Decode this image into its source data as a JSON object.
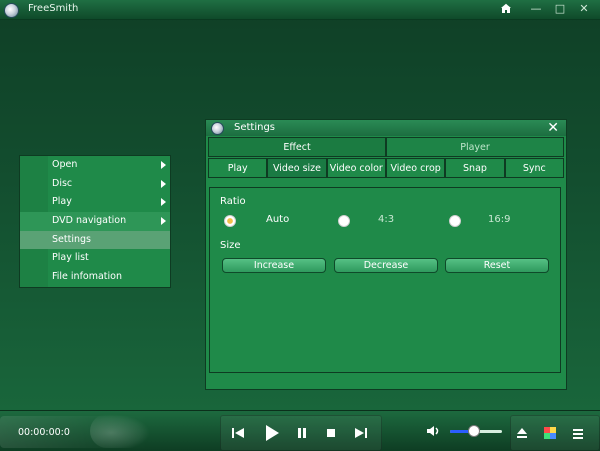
{
  "app": {
    "title": "FreeSmith"
  },
  "window_controls": {
    "home_icon": "home-icon",
    "minimize_icon": "minimize-icon",
    "restore_icon": "restore-icon",
    "close_icon": "close-icon"
  },
  "context_menu": {
    "items": [
      {
        "label": "Open",
        "has_submenu": true
      },
      {
        "label": "Disc",
        "has_submenu": true
      },
      {
        "label": "Play",
        "has_submenu": true
      },
      {
        "label": "DVD navigation",
        "has_submenu": true
      },
      {
        "label": "Settings",
        "has_submenu": false
      },
      {
        "label": "Play list",
        "has_submenu": false
      },
      {
        "label": "File infomation",
        "has_submenu": false
      }
    ]
  },
  "settings_dialog": {
    "title": "Settings",
    "tabs_top": [
      {
        "label": "Effect"
      },
      {
        "label": "Player"
      }
    ],
    "tabs_sub": [
      {
        "label": "Play"
      },
      {
        "label": "Video size"
      },
      {
        "label": "Video color"
      },
      {
        "label": "Video crop"
      },
      {
        "label": "Snap"
      },
      {
        "label": "Sync"
      }
    ],
    "selected_sub_tab": "Video size",
    "ratio": {
      "label": "Ratio",
      "options": [
        {
          "label": "Auto",
          "checked": true
        },
        {
          "label": "4:3",
          "checked": false
        },
        {
          "label": "16:9",
          "checked": false
        }
      ]
    },
    "size": {
      "label": "Size",
      "buttons": [
        {
          "label": "Increase"
        },
        {
          "label": "Decrease"
        },
        {
          "label": "Reset"
        }
      ]
    }
  },
  "player_bar": {
    "time": "00:00:00:0",
    "volume_level": 0.45,
    "icons": {
      "previous": "skip-previous-icon",
      "play": "play-icon",
      "pause": "pause-icon",
      "stop": "stop-icon",
      "next": "skip-next-icon",
      "volume": "volume-icon",
      "eject": "eject-icon",
      "color": "color-icon",
      "playlist": "playlist-icon"
    }
  },
  "colors": {
    "background": "#134e2f",
    "panel": "#1f8a49",
    "accent_blue": "#2b5dff"
  }
}
